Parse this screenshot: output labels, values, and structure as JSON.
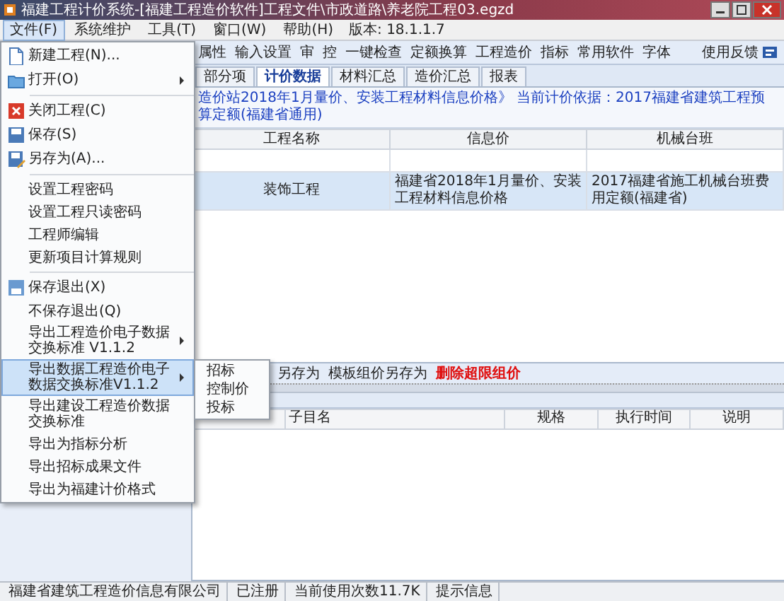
{
  "window": {
    "title": "福建工程计价系统-[福建工程造价软件]工程文件\\市政道路\\养老院工程03.egzd"
  },
  "menubar": {
    "items": [
      {
        "label": "文件(F)",
        "selected": true
      },
      {
        "label": "系统维护",
        "selected": false
      },
      {
        "label": "工具(T)",
        "selected": false
      },
      {
        "label": "窗口(W)",
        "selected": false
      },
      {
        "label": "帮助(H)",
        "selected": false
      }
    ],
    "version": "版本: 18.1.1.7"
  },
  "toolbar": {
    "items": [
      "属性",
      "输入设置",
      "审",
      "控",
      "一键检查",
      "定额换算",
      "工程造价",
      "指标",
      "常用软件",
      "字体"
    ],
    "feedback": "使用反馈"
  },
  "tabs": [
    {
      "label": "部分项",
      "selected": false
    },
    {
      "label": "计价数据",
      "selected": true
    },
    {
      "label": "材料汇总",
      "selected": false
    },
    {
      "label": "造价汇总",
      "selected": false
    },
    {
      "label": "报表",
      "selected": false
    }
  ],
  "info": "造价站2018年1月量价、安装工程材料信息价格》 当前计价依据：2017福建省建筑工程预算定额(福建省通用)",
  "project_table": {
    "columns": [
      "工程名称",
      "信息价",
      "机械台班"
    ],
    "rows": [
      {
        "cells": [
          "装饰工程",
          "福建省2018年1月量价、安装工程材料信息价格",
          "2017福建省施工机械台班费用定额(福建省)"
        ],
        "selected": true
      }
    ]
  },
  "lower_toolbar": [
    {
      "label": "另存为",
      "kind": "normal"
    },
    {
      "label": "模板组价另存为",
      "kind": "normal"
    },
    {
      "label": "删除超限组价",
      "kind": "warning"
    }
  ],
  "lower_table": {
    "columns": [
      "子目名",
      "规格",
      "执行时间",
      "说明"
    ]
  },
  "file_menu": {
    "items": [
      {
        "kind": "item",
        "label": "新建工程(N)...",
        "has_submenu": false,
        "selected": false
      },
      {
        "kind": "item",
        "label": "打开(O)",
        "has_submenu": true,
        "selected": false
      },
      {
        "kind": "separator"
      },
      {
        "kind": "item",
        "label": "关闭工程(C)",
        "has_submenu": false,
        "selected": false
      },
      {
        "kind": "item",
        "label": "保存(S)",
        "has_submenu": false,
        "selected": false
      },
      {
        "kind": "item",
        "label": "另存为(A)...",
        "has_submenu": false,
        "selected": false
      },
      {
        "kind": "separator"
      },
      {
        "kind": "item",
        "label": "设置工程密码",
        "has_submenu": false,
        "selected": false
      },
      {
        "kind": "item",
        "label": "设置工程只读密码",
        "has_submenu": false,
        "selected": false
      },
      {
        "kind": "item",
        "label": "工程师编辑",
        "has_submenu": false,
        "selected": false
      },
      {
        "kind": "item",
        "label": "更新项目计算规则",
        "has_submenu": false,
        "selected": false
      },
      {
        "kind": "separator"
      },
      {
        "kind": "item",
        "label": "保存退出(X)",
        "has_submenu": false,
        "selected": false
      },
      {
        "kind": "item",
        "label": "不保存退出(Q)",
        "has_submenu": false,
        "selected": false
      },
      {
        "kind": "item",
        "label": "导出工程造价电子数据交换标准 V1.1.2",
        "has_submenu": true,
        "selected": false
      },
      {
        "kind": "item",
        "label": "导出数据工程造价电子数据交换标准V1.1.2",
        "has_submenu": true,
        "selected": true
      },
      {
        "kind": "item",
        "label": "导出建设工程造价数据交换标准",
        "has_submenu": false,
        "selected": false
      },
      {
        "kind": "item",
        "label": "导出为指标分析",
        "has_submenu": false,
        "selected": false
      },
      {
        "kind": "item",
        "label": "导出招标成果文件",
        "has_submenu": false,
        "selected": false
      },
      {
        "kind": "item",
        "label": "导出为福建计价格式",
        "has_submenu": false,
        "selected": false
      }
    ]
  },
  "submenu": {
    "items": [
      "招标",
      "控制价",
      "投标"
    ]
  },
  "status_bar": [
    "福建省建筑工程造价信息有限公司",
    "已注册",
    "当前使用次数11.7K",
    "提示信息"
  ]
}
